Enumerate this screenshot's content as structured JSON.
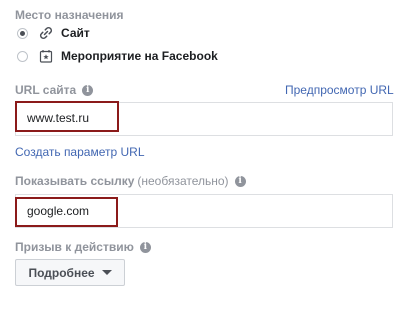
{
  "destination": {
    "title": "Место назначения",
    "options": [
      {
        "label": "Сайт",
        "icon": "link-icon",
        "selected": true
      },
      {
        "label": "Мероприятие на Facebook",
        "icon": "calendar-star-icon",
        "selected": false
      }
    ]
  },
  "url_field": {
    "label": "URL сайта",
    "preview_link": "Предпросмотр URL",
    "value": "www.test.ru",
    "create_param_link": "Создать параметр URL"
  },
  "display_link": {
    "label": "Показывать ссылку",
    "optional_note": "(необязательно)",
    "value": "google.com"
  },
  "cta": {
    "label": "Призыв к действию",
    "button_label": "Подробнее"
  },
  "colors": {
    "link": "#4267b2",
    "highlight_border": "#8b1a1a",
    "muted_label": "#90949c"
  }
}
